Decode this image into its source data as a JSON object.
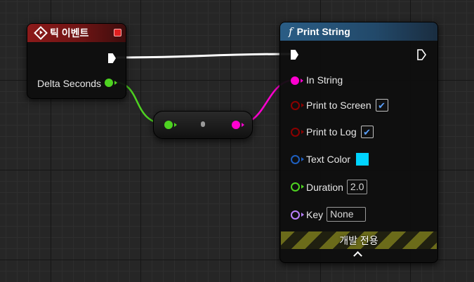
{
  "event_node": {
    "title": "틱 이벤트",
    "output_pin_label": "Delta Seconds"
  },
  "print_node": {
    "title": "Print String",
    "func_symbol": "f",
    "pins": {
      "in_string": "In String",
      "print_to_screen": "Print to Screen",
      "print_to_log": "Print to Log",
      "text_color": "Text Color",
      "duration": "Duration",
      "key": "Key"
    },
    "values": {
      "print_to_screen_checked": true,
      "print_to_log_checked": true,
      "text_color": "#00d4ff",
      "duration": "2.0",
      "key": "None"
    },
    "dev_only_label": "개발 전용"
  },
  "colors": {
    "float_pin": "#4ed321",
    "string_pin": "#ff00d0",
    "bool_pin": "#8b0000",
    "struct_pin": "#1e5fbf",
    "name_pin": "#b980ff",
    "exec_wire": "#ffffff"
  }
}
